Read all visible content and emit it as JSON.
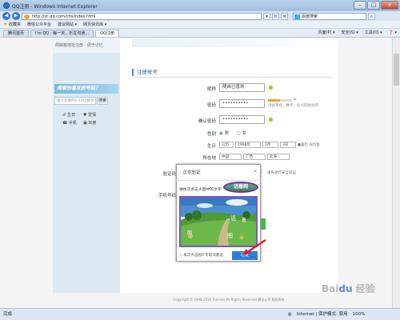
{
  "window": {
    "title": "QQ注册 - Windows Internet Explorer",
    "close": "×",
    "minimize": "–",
    "maximize": "□"
  },
  "address_bar": {
    "back": "◀",
    "forward": "▶",
    "url": "http://zc.qq.com/chs/index.html",
    "search_placeholder": "百度搜索"
  },
  "favorites_bar": {
    "favorites_label": "收藏夹",
    "items": [
      "建议网站 ▾",
      "网页快讯库 ▾",
      "微信公众平台"
    ]
  },
  "tabs": {
    "items": [
      "腾讯首页",
      "I'm QQ - 每一天，乐在沟通…",
      "QQ注册"
    ],
    "tools": [
      "页面(P) ▾",
      "安全(S) ▾",
      "工具(O) ▾",
      "❓ ▾"
    ]
  },
  "sidebar": {
    "top_text": "周邮箱地址注册 · 便于记忆",
    "promo": "搜索你喜欢的号码？",
    "search_placeholder": "输入您要的6-10位数字",
    "search_button": "搜索",
    "links": [
      "生日",
      "爱情",
      "手机",
      "年度"
    ]
  },
  "form": {
    "section_title": "注册帐号",
    "fields": {
      "nickname": {
        "label": "昵称",
        "value": "随自已喜欢"
      },
      "password": {
        "label": "密码",
        "value": "••••••••••"
      },
      "confirm": {
        "label": "确认密码",
        "value": "••••••••••"
      },
      "gender": {
        "label": "性别",
        "options": [
          "男",
          "女"
        ]
      },
      "birthday": {
        "label": "生日",
        "calendar": "公历",
        "year": "1998年",
        "month": "2月",
        "day": "3日",
        "hint": "●国历 农历生"
      },
      "location": {
        "label": "所在地",
        "country": "中国",
        "province": "广西",
        "city": "北海"
      },
      "captcha": {
        "label": "验证码",
        "hint": "请先进行安全验证"
      },
      "phone": {
        "label": "手机号码"
      }
    },
    "password_hints": [
      "试试字母，数字，标点的组合吧",
      "中"
    ]
  },
  "captcha_popup": {
    "title": "正在验证",
    "close": "×",
    "prompt": "请依次点击大图中的文字",
    "target_word": "话着网",
    "footer": "再次点击图片可取消重选",
    "verify_button": "验证"
  },
  "copyright": "Copyright © 1998-2016 Tencent All Rights Reserved 腾讯公司 版权所有",
  "status_bar": {
    "left": "完成",
    "zone": "Internet | 保护模式: 禁用",
    "zoom": "100%"
  },
  "watermark": "Baidu 经验"
}
